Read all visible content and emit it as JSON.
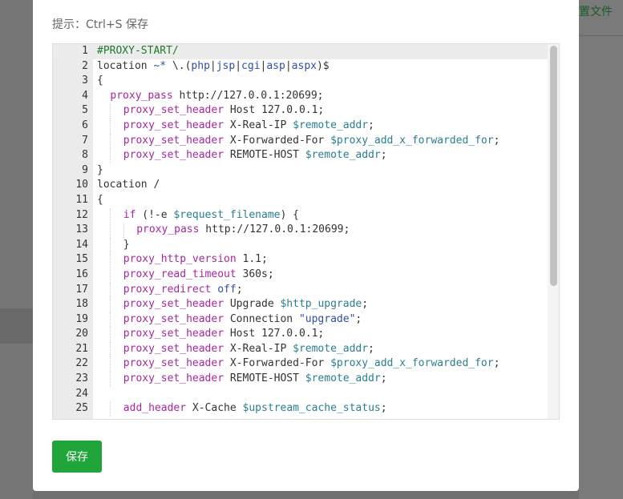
{
  "background": {
    "right_link": "置文件"
  },
  "dialog": {
    "hint": "提示：Ctrl+S 保存",
    "save_label": "保存"
  },
  "editor": {
    "lines": [
      {
        "num": "1",
        "indent": 0,
        "tokens": [
          {
            "t": "#PROXY-START/",
            "c": "cmt"
          }
        ]
      },
      {
        "num": "2",
        "indent": 0,
        "tokens": [
          {
            "t": "location ",
            "c": ""
          },
          {
            "t": "~*",
            "c": "op"
          },
          {
            "t": " \\.(",
            "c": ""
          },
          {
            "t": "php",
            "c": "str"
          },
          {
            "t": "|",
            "c": ""
          },
          {
            "t": "jsp",
            "c": "str"
          },
          {
            "t": "|",
            "c": ""
          },
          {
            "t": "cgi",
            "c": "str"
          },
          {
            "t": "|",
            "c": ""
          },
          {
            "t": "asp",
            "c": "str"
          },
          {
            "t": "|",
            "c": ""
          },
          {
            "t": "aspx",
            "c": "str"
          },
          {
            "t": ")$",
            "c": ""
          }
        ]
      },
      {
        "num": "3",
        "indent": 0,
        "tokens": [
          {
            "t": "{",
            "c": ""
          }
        ]
      },
      {
        "num": "4",
        "indent": 1,
        "tokens": [
          {
            "t": "proxy_pass",
            "c": "kw"
          },
          {
            "t": " http://127.0.0.1:20699;",
            "c": ""
          }
        ]
      },
      {
        "num": "5",
        "indent": 2,
        "tokens": [
          {
            "t": "proxy_set_header",
            "c": "kw"
          },
          {
            "t": " Host 127.0.0.1;",
            "c": ""
          }
        ]
      },
      {
        "num": "6",
        "indent": 2,
        "tokens": [
          {
            "t": "proxy_set_header",
            "c": "kw"
          },
          {
            "t": " X-Real-IP ",
            "c": ""
          },
          {
            "t": "$remote_addr",
            "c": "var"
          },
          {
            "t": ";",
            "c": ""
          }
        ]
      },
      {
        "num": "7",
        "indent": 2,
        "tokens": [
          {
            "t": "proxy_set_header",
            "c": "kw"
          },
          {
            "t": " X-Forwarded-For ",
            "c": ""
          },
          {
            "t": "$proxy_add_x_forwarded_for",
            "c": "var"
          },
          {
            "t": ";",
            "c": ""
          }
        ]
      },
      {
        "num": "8",
        "indent": 2,
        "tokens": [
          {
            "t": "proxy_set_header",
            "c": "kw"
          },
          {
            "t": " REMOTE-HOST ",
            "c": ""
          },
          {
            "t": "$remote_addr",
            "c": "var"
          },
          {
            "t": ";",
            "c": ""
          }
        ]
      },
      {
        "num": "9",
        "indent": 0,
        "tokens": [
          {
            "t": "}",
            "c": ""
          }
        ]
      },
      {
        "num": "10",
        "indent": 0,
        "tokens": [
          {
            "t": "location /",
            "c": ""
          }
        ]
      },
      {
        "num": "11",
        "indent": 0,
        "tokens": [
          {
            "t": "{",
            "c": ""
          }
        ]
      },
      {
        "num": "12",
        "indent": 2,
        "tokens": [
          {
            "t": "if",
            "c": "kw"
          },
          {
            "t": " (!-e ",
            "c": ""
          },
          {
            "t": "$request_filename",
            "c": "var"
          },
          {
            "t": ") {",
            "c": ""
          }
        ]
      },
      {
        "num": "13",
        "indent": 3,
        "tokens": [
          {
            "t": "proxy_pass",
            "c": "kw"
          },
          {
            "t": " http://127.0.0.1:20699;",
            "c": ""
          }
        ]
      },
      {
        "num": "14",
        "indent": 2,
        "tokens": [
          {
            "t": "}",
            "c": ""
          }
        ]
      },
      {
        "num": "15",
        "indent": 2,
        "tokens": [
          {
            "t": "proxy_http_version",
            "c": "kw"
          },
          {
            "t": " 1.1;",
            "c": ""
          }
        ]
      },
      {
        "num": "16",
        "indent": 2,
        "tokens": [
          {
            "t": "proxy_read_timeout",
            "c": "kw"
          },
          {
            "t": " 360s;",
            "c": ""
          }
        ]
      },
      {
        "num": "17",
        "indent": 2,
        "tokens": [
          {
            "t": "proxy_redirect",
            "c": "kw"
          },
          {
            "t": " ",
            "c": ""
          },
          {
            "t": "off",
            "c": "str"
          },
          {
            "t": ";",
            "c": ""
          }
        ]
      },
      {
        "num": "18",
        "indent": 2,
        "tokens": [
          {
            "t": "proxy_set_header",
            "c": "kw"
          },
          {
            "t": " Upgrade ",
            "c": ""
          },
          {
            "t": "$http_upgrade",
            "c": "var"
          },
          {
            "t": ";",
            "c": ""
          }
        ]
      },
      {
        "num": "19",
        "indent": 2,
        "tokens": [
          {
            "t": "proxy_set_header",
            "c": "kw"
          },
          {
            "t": " Connection ",
            "c": ""
          },
          {
            "t": "\"upgrade\"",
            "c": "str"
          },
          {
            "t": ";",
            "c": ""
          }
        ]
      },
      {
        "num": "20",
        "indent": 2,
        "tokens": [
          {
            "t": "proxy_set_header",
            "c": "kw"
          },
          {
            "t": " Host 127.0.0.1;",
            "c": ""
          }
        ]
      },
      {
        "num": "21",
        "indent": 2,
        "tokens": [
          {
            "t": "proxy_set_header",
            "c": "kw"
          },
          {
            "t": " X-Real-IP ",
            "c": ""
          },
          {
            "t": "$remote_addr",
            "c": "var"
          },
          {
            "t": ";",
            "c": ""
          }
        ]
      },
      {
        "num": "22",
        "indent": 2,
        "tokens": [
          {
            "t": "proxy_set_header",
            "c": "kw"
          },
          {
            "t": " X-Forwarded-For ",
            "c": ""
          },
          {
            "t": "$proxy_add_x_forwarded_for",
            "c": "var"
          },
          {
            "t": ";",
            "c": ""
          }
        ]
      },
      {
        "num": "23",
        "indent": 2,
        "tokens": [
          {
            "t": "proxy_set_header",
            "c": "kw"
          },
          {
            "t": " REMOTE-HOST ",
            "c": ""
          },
          {
            "t": "$remote_addr",
            "c": "var"
          },
          {
            "t": ";",
            "c": ""
          }
        ]
      },
      {
        "num": "24",
        "indent": 0,
        "tokens": []
      },
      {
        "num": "25",
        "indent": 2,
        "tokens": [
          {
            "t": "add_header",
            "c": "kw"
          },
          {
            "t": " X-Cache ",
            "c": ""
          },
          {
            "t": "$upstream_cache_status",
            "c": "var"
          },
          {
            "t": ";",
            "c": ""
          }
        ]
      }
    ],
    "active_line": "1"
  },
  "colors": {
    "accent": "#20a53a",
    "keyword": "#a626a4",
    "variable": "#2a7e91",
    "comment": "#1f7a2e"
  }
}
